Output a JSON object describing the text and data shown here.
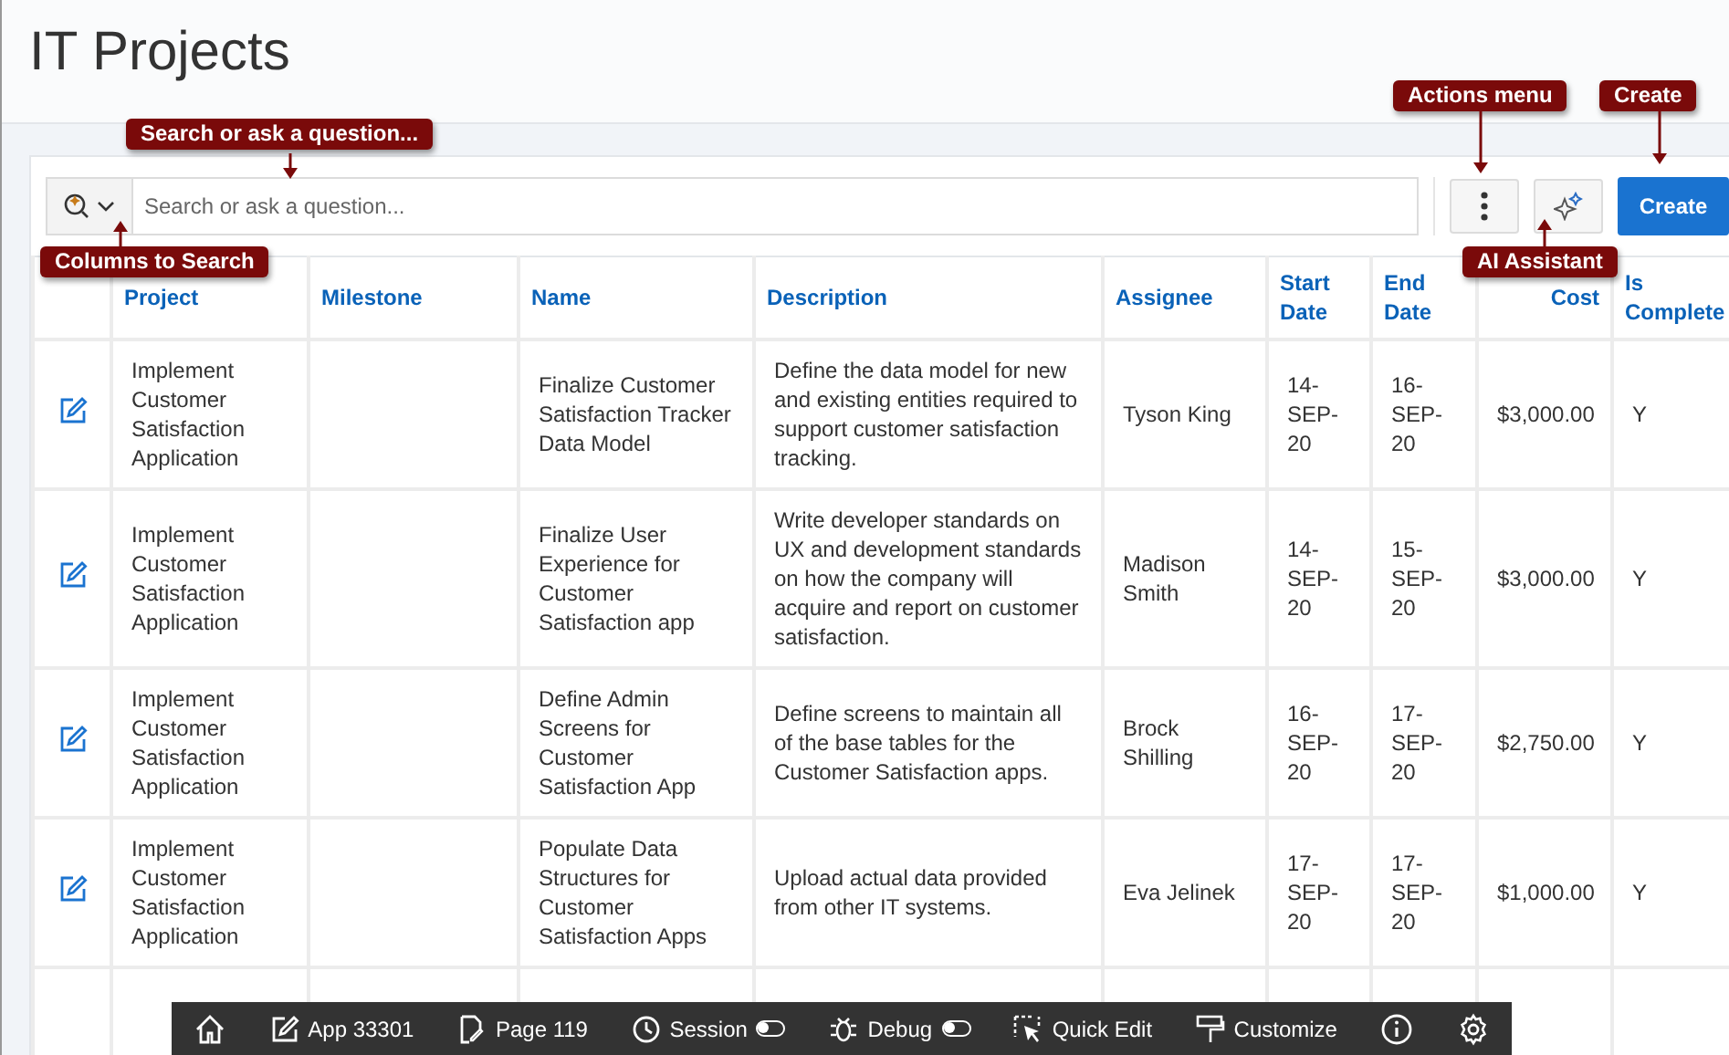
{
  "page_title": "IT Projects",
  "search": {
    "placeholder": "Search or ask a question..."
  },
  "create_button": "Create",
  "table": {
    "columns": [
      {
        "label": "Project"
      },
      {
        "label": "Milestone"
      },
      {
        "label": "Name"
      },
      {
        "label": "Description"
      },
      {
        "label": "Assignee"
      },
      {
        "label": "Start Date"
      },
      {
        "label": "End Date"
      },
      {
        "label": "Cost"
      },
      {
        "label": "Is Complete"
      }
    ],
    "rows": [
      {
        "project": "Implement Customer Satisfaction Application",
        "name": "Finalize Customer Satisfaction Tracker Data Model",
        "description": "Define the data model for new and existing entities required to support customer satisfaction tracking.",
        "assignee": "Tyson King",
        "start_date": "14-SEP-20",
        "end_date": "16-SEP-20",
        "cost": "$3,000.00",
        "is_complete": "Y"
      },
      {
        "project": "Implement Customer Satisfaction Application",
        "name": "Finalize User Experience for Customer Satisfaction app",
        "description": "Write developer standards on UX and development standards on how the company will acquire and report on customer satisfaction.",
        "assignee": "Madison Smith",
        "start_date": "14-SEP-20",
        "end_date": "15-SEP-20",
        "cost": "$3,000.00",
        "is_complete": "Y"
      },
      {
        "project": "Implement Customer Satisfaction Application",
        "name": "Define Admin Screens for Customer Satisfaction App",
        "description": "Define screens to maintain all of the base tables for the Customer Satisfaction apps.",
        "assignee": "Brock Shilling",
        "start_date": "16-SEP-20",
        "end_date": "17-SEP-20",
        "cost": "$2,750.00",
        "is_complete": "Y"
      },
      {
        "project": "Implement Customer Satisfaction Application",
        "name": "Populate Data Structures for Customer Satisfaction Apps",
        "description": "Upload actual data provided from other IT systems.",
        "assignee": "Eva Jelinek",
        "start_date": "17-SEP-20",
        "end_date": "17-SEP-20",
        "cost": "$1,000.00",
        "is_complete": "Y"
      }
    ]
  },
  "annotations": [
    {
      "text": "Search or ask a question..."
    },
    {
      "text": "Columns to Search"
    },
    {
      "text": "Actions menu"
    },
    {
      "text": "Create"
    },
    {
      "text": "AI Assistant"
    }
  ],
  "dev_toolbar": [
    {
      "kind": "home"
    },
    {
      "kind": "app",
      "label": "App 33301"
    },
    {
      "kind": "page",
      "label": "Page 119"
    },
    {
      "kind": "session",
      "label": "Session",
      "on": false
    },
    {
      "kind": "debug",
      "label": "Debug",
      "on": false
    },
    {
      "kind": "quickedit",
      "label": "Quick Edit"
    },
    {
      "kind": "customize",
      "label": "Customize"
    },
    {
      "kind": "info"
    },
    {
      "kind": "settings"
    }
  ]
}
